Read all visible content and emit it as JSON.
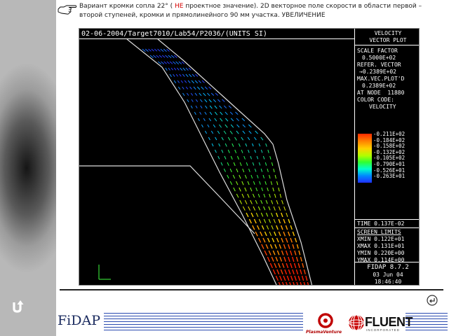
{
  "caption": {
    "part1": "Вариант кромки сопла 22° ( ",
    "highlight": "НЕ",
    "part2": " проектное значение). 2D  векторное поле скорости в области первой – второй ступеней, кромки и прямолинейного 90 мм участка. УВЕЛИЧЕНИЕ"
  },
  "plot": {
    "header": "02-06-2004/Target7010/Lab54/P2036/(UNITS SI)",
    "title_lines": [
      "VELOCITY",
      "VECTOR PLOT"
    ],
    "scale_factor_label": "SCALE FACTOR",
    "scale_factor_value": "0.5000E+02",
    "refer_vector_label": "REFER. VECTOR",
    "refer_vector_value": "→0.2389E+02",
    "max_vec_label": "MAX.VEC.PLOT'D",
    "max_vec_value": "0.2389E+02",
    "at_node_label": "AT NODE",
    "at_node_value": "11880",
    "color_code_label": "COLOR CODE:",
    "color_code_quantity": "VELOCITY",
    "legend_values": [
      "-0.211E+02",
      "-0.184E+02",
      "-0.158E+02",
      "-0.132E+02",
      "-0.105E+02",
      "-0.790E+01",
      "-0.526E+01",
      "-0.263E+01"
    ],
    "time_label": "TIME",
    "time_value": "0.137E-02",
    "screen_limits_label": "SCREEN LIMITS",
    "xmin_label": "XMIN",
    "xmin_value": "0.122E+01",
    "xmax_label": "XMAX",
    "xmax_value": "0.131E+01",
    "ymin_label": "YMIN",
    "ymin_value": "0.220E+00",
    "ymax_label": "YMAX",
    "ymax_value": "0.114E+00",
    "software": "FIDAP 8.7.2",
    "date": "03 Jun 04",
    "clock": "18:46:40"
  },
  "footer": {
    "fidap_logo": "FiDAP",
    "plasma_logo": "PlasmaVenture",
    "fluent_logo": "FLUENT",
    "fluent_sub": "INCORPORATED"
  },
  "colors": {
    "highlight": "#d40000",
    "plot_bg": "#000000",
    "wall": "#dddddd",
    "footer_lines": "#2a4ab0"
  }
}
